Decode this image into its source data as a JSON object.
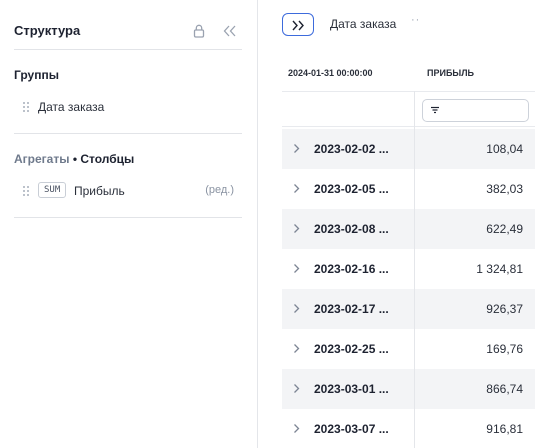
{
  "structure_panel": {
    "title": "Структура",
    "lock_icon": "lock-icon",
    "collapse_icon": "double-chevron-left-icon",
    "groups": {
      "title": "Группы",
      "fields": [
        {
          "label": "Дата заказа"
        }
      ]
    },
    "aggregates": {
      "title_prefix": "Агрегаты",
      "title_separator": "•",
      "title_suffix": "Столбцы",
      "fields": [
        {
          "function": "SUM",
          "label": "Прибыль",
          "edit_label": "(ред.)"
        }
      ]
    }
  },
  "toolbar": {
    "expand_icon": "double-chevron-right-icon",
    "row_field_label": "Дата заказа",
    "row_field_menu": "··"
  },
  "grid": {
    "header_group": "2024-01-31 00:00:00",
    "header_value": "ПРИБЫЛЬ",
    "filter_icon": "filter-icon",
    "rows": [
      {
        "date": "2023-02-02 ...",
        "value": "108,04"
      },
      {
        "date": "2023-02-05 ...",
        "value": "382,03"
      },
      {
        "date": "2023-02-08 ...",
        "value": "622,49"
      },
      {
        "date": "2023-02-16 ...",
        "value": "1 324,81"
      },
      {
        "date": "2023-02-17 ...",
        "value": "926,37"
      },
      {
        "date": "2023-02-25 ...",
        "value": "169,76"
      },
      {
        "date": "2023-03-01 ...",
        "value": "866,74"
      },
      {
        "date": "2023-03-07 ...",
        "value": "916,81"
      }
    ]
  },
  "colors": {
    "accent": "#3d6bdc",
    "row_alt": "#f3f4f6",
    "divider": "#e4e6ea",
    "text": "#1d2230",
    "muted": "#6f7a8c"
  }
}
